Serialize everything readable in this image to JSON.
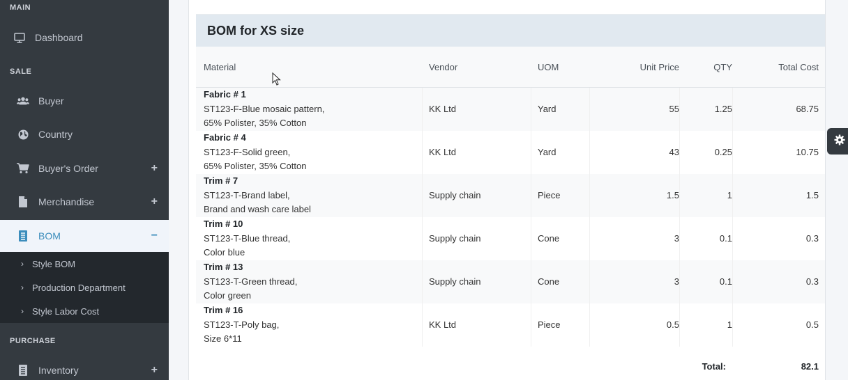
{
  "sidebar": {
    "sections": {
      "main": "MAIN",
      "sale": "SALE",
      "purchase": "PURCHASE"
    },
    "items": {
      "dashboard": {
        "label": "Dashboard",
        "icon": "monitor-icon"
      },
      "buyer": {
        "label": "Buyer",
        "icon": "users-icon"
      },
      "country": {
        "label": "Country",
        "icon": "globe-icon"
      },
      "buyers_order": {
        "label": "Buyer's Order",
        "icon": "cart-icon",
        "expander": "+"
      },
      "merchandise": {
        "label": "Merchandise",
        "icon": "file-icon",
        "expander": "+"
      },
      "bom": {
        "label": "BOM",
        "icon": "list-icon",
        "expander": "−"
      },
      "inventory": {
        "label": "Inventory",
        "icon": "list-icon",
        "expander": "+"
      }
    },
    "bom_sub": [
      {
        "label": "Style BOM"
      },
      {
        "label": "Production Department"
      },
      {
        "label": "Style Labor Cost"
      }
    ]
  },
  "bom": {
    "title": "BOM for XS size",
    "columns": {
      "material": "Material",
      "vendor": "Vendor",
      "uom": "UOM",
      "unit_price": "Unit Price",
      "qty": "QTY",
      "total_cost": "Total Cost"
    },
    "rows": [
      {
        "name": "Fabric # 1",
        "desc1": "ST123-F-Blue mosaic pattern,",
        "desc2": "65% Polister, 35% Cotton",
        "vendor": "KK Ltd",
        "uom": "Yard",
        "unit_price": "55",
        "qty": "1.25",
        "total": "68.75"
      },
      {
        "name": "Fabric # 4",
        "desc1": "ST123-F-Solid green,",
        "desc2": "65% Polister, 35% Cotton",
        "vendor": "KK Ltd",
        "uom": "Yard",
        "unit_price": "43",
        "qty": "0.25",
        "total": "10.75"
      },
      {
        "name": "Trim # 7",
        "desc1": "ST123-T-Brand label,",
        "desc2": "Brand and wash care label",
        "vendor": "Supply chain",
        "uom": "Piece",
        "unit_price": "1.5",
        "qty": "1",
        "total": "1.5"
      },
      {
        "name": "Trim # 10",
        "desc1": "ST123-T-Blue thread,",
        "desc2": "Color blue",
        "vendor": "Supply chain",
        "uom": "Cone",
        "unit_price": "3",
        "qty": "0.1",
        "total": "0.3"
      },
      {
        "name": "Trim # 13",
        "desc1": "ST123-T-Green thread,",
        "desc2": "Color green",
        "vendor": "Supply chain",
        "uom": "Cone",
        "unit_price": "3",
        "qty": "0.1",
        "total": "0.3"
      },
      {
        "name": "Trim # 16",
        "desc1": "ST123-T-Poly bag,",
        "desc2": "Size 6*11",
        "vendor": "KK Ltd",
        "uom": "Piece",
        "unit_price": "0.5",
        "qty": "1",
        "total": "0.5"
      }
    ],
    "total_label": "Total:",
    "total_value": "82.1"
  },
  "settings_button": {
    "icon": "gear-icon"
  },
  "colors": {
    "sidebar_bg": "#343a40",
    "submenu_bg": "#23282d",
    "active_bg": "#f0f4fa",
    "accent": "#3c8dbc",
    "title_bar_bg": "#e1e9f0"
  }
}
